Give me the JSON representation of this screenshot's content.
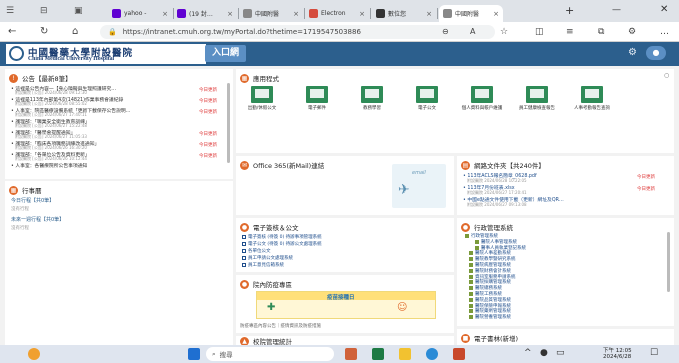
{
  "browser": {
    "tabs": [
      {
        "label": "yahoo -",
        "color": "#6001d2"
      },
      {
        "label": "(19 封…",
        "color": "#6001d2"
      },
      {
        "label": "中國附醫",
        "color": "#888888"
      },
      {
        "label": "Electron",
        "color": "#d54b3d"
      },
      {
        "label": "數位您",
        "color": "#333333"
      },
      {
        "label": "中國附醫",
        "color": "#888888"
      }
    ],
    "new_tab": "+",
    "url": "https://intranet.cmuh.org.tw/myPortal.do?thetime=1719547503886"
  },
  "header": {
    "hospital_zh": "中國醫藥大學附設醫院",
    "hospital_en": "China Medical University Hospital",
    "entry": "入口網"
  },
  "announcements": {
    "title": "公告【最新8筆】",
    "items": [
      {
        "text": "• 這裡是公告內容一【身心障礙與生理照護研究…",
        "sub": "附設醫院 [公告] 2024/06/28 09:12:30",
        "tag": "今日更新"
      },
      {
        "text": "• 這裡是113年內部第4次(14821)作業事務會議紀錄",
        "sub": "附設醫院 [公告] 2024/06/28 08:55:02",
        "tag": "今日更新"
      },
      {
        "text": "• 人事室：院區醫療設備系統「更新下載保存公告說明…",
        "sub": "附設醫院 [公告] 2024/06/27 17:40:11",
        "tag": "今日更新"
      },
      {
        "text": "• 護理部：「職業安全衛生教育訓練」",
        "sub": "附設醫院 [公告] 2024/06/27 15:22:48",
        "tag": ""
      },
      {
        "text": "• 護理部：「醫學會提醒通知」",
        "sub": "附設醫院 [公告] 2024/06/27 11:05:33",
        "tag": "今日更新"
      },
      {
        "text": "• 護理部：「臨床各項職務訓練改進通知」",
        "sub": "附設醫院 [公告] 2024/06/26 16:30:20",
        "tag": "今日更新"
      },
      {
        "text": "• 護理部：「各單位公告及資料更新」",
        "sub": "附設醫院 [公告] 2024/06/26 10:12:44",
        "tag": "今日更新"
      },
      {
        "text": "• 人事室：各醫療院所公告事項通知",
        "sub": "",
        "tag": ""
      }
    ]
  },
  "schedule": {
    "title": "行事曆",
    "items": [
      {
        "text": "今日行程【共0筆】",
        "sub": "沒有行程"
      },
      {
        "text": "未來一週行程【共0筆】",
        "sub": "沒有行程"
      }
    ]
  },
  "apps": {
    "title": "應用程式",
    "items": [
      "出勤/休假公文",
      "電子郵件",
      "教務學習",
      "電子公文",
      "個人資料與帳戶維護",
      "員工健康檢查報告",
      "人事考勤報告查詢"
    ],
    "dot": "○"
  },
  "office365": {
    "title": "Office 365(新Mail)連結",
    "badge": "email"
  },
  "documents": {
    "title": "網路文件夾【共240件】",
    "items": [
      {
        "text": "• 113年ACLS報名簡章_0628.pdf",
        "sub": "附設醫院 2024/06/28 10:22:05",
        "tag": "今日更新"
      },
      {
        "text": "• 113年7月份班表.xlsx",
        "sub": "附設醫院 2024/06/27 17:20:41",
        "tag": "今日更新"
      },
      {
        "text": "• 中國e點通文件使用下載（更新）網址及QR…",
        "sub": "附設醫院 2024/06/27 09:13:08",
        "tag": ""
      }
    ]
  },
  "ecards": {
    "title": "電子簽核＆公文",
    "items": [
      "電子簽核 (待簽 0) 待辦事項管理系統",
      "電子公文 (待簽 0) 待辦公文處理系統",
      "各單位公文",
      "員工申請公文處理系統",
      "員工意見信箱系統"
    ]
  },
  "admin": {
    "title": "行政管理系統",
    "tree": [
      "行政管理系統",
      "醫院人事管理系統",
      "醫事人員執業登記系統",
      "醫院人事差勤系統",
      "醫院教學暨研究系統",
      "醫院病歷管理系統",
      "醫院財務會計系統",
      "資訊室服務申請系統",
      "醫院採購管理系統",
      "醫院總務系統",
      "醫院工務系統",
      "醫院品質管理系統",
      "醫院保險申報系統",
      "醫院藥劑管理系統",
      "醫院營養管理系統"
    ]
  },
  "campaign": {
    "title": "院內防疫專區",
    "banner_text": "疫苗接種日",
    "caption": "防疫專區內容公告｜疫情資訊及防疫措施"
  },
  "bookmarks": {
    "title": "電子書林(新增)"
  },
  "school": {
    "title": "校院管理統計"
  },
  "taskbar": {
    "search": "搜尋",
    "time": "下午 12:05",
    "date": "2024/6/28"
  },
  "colors": {
    "header_bg": "#2c5f8d",
    "panel_icon": "#e06a2c",
    "apps_green": "#2e8b57",
    "badge_red": "#d33333"
  }
}
